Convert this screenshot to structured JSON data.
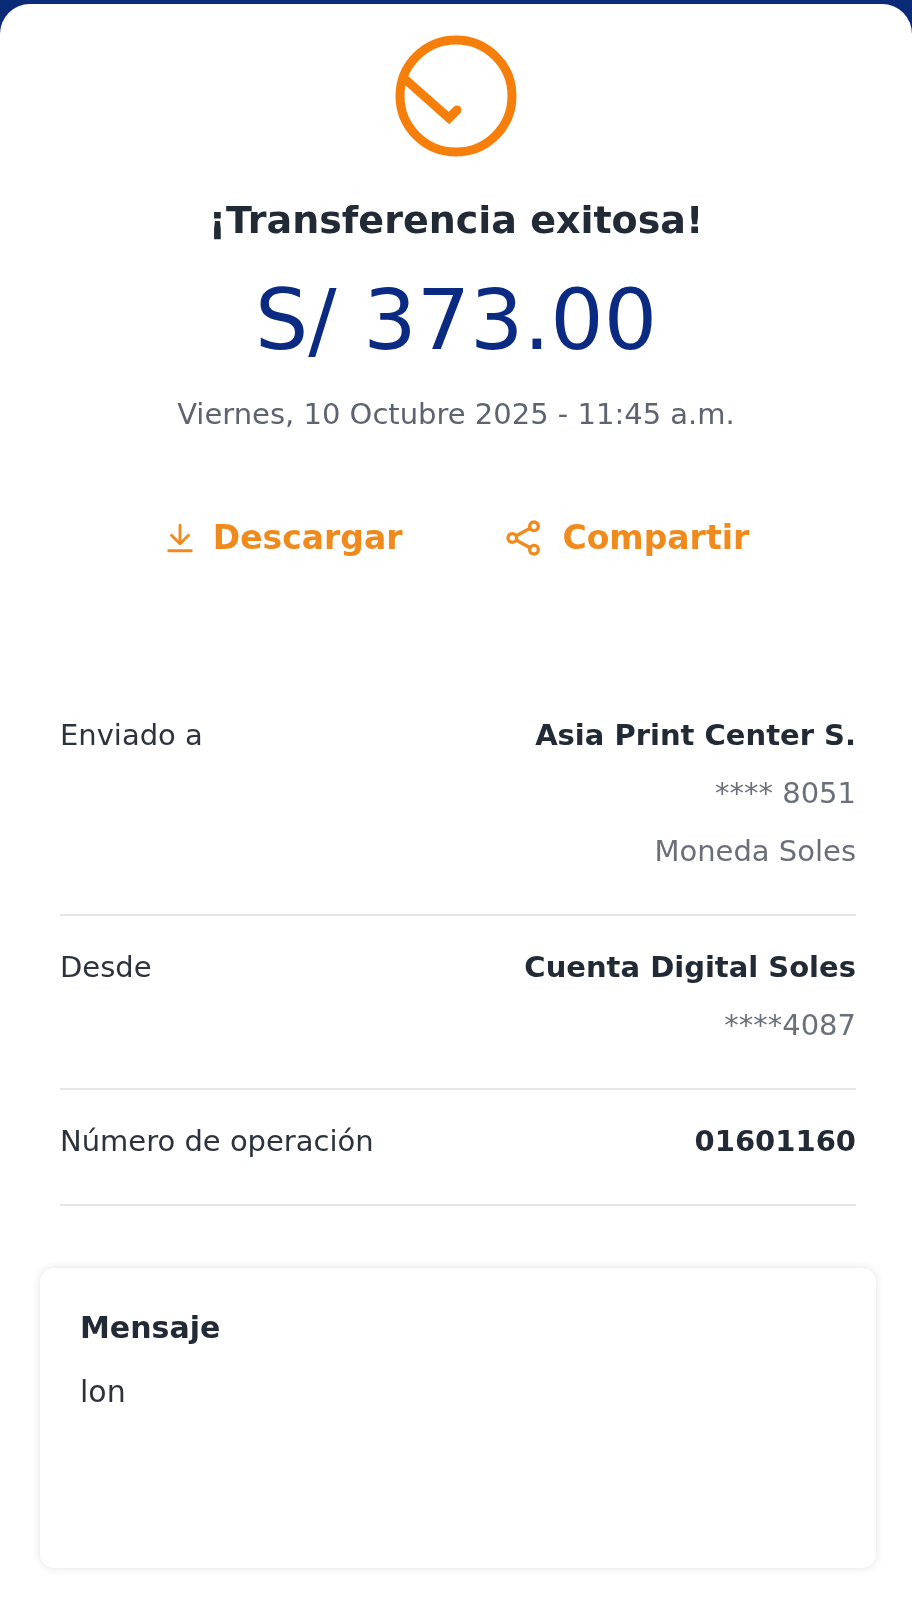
{
  "title": "¡Transferencia exitosa!",
  "amount": "S/ 373.00",
  "date": "Viernes, 10 Octubre 2025 - 11:45 a.m.",
  "actions": [
    {
      "kind": "download",
      "label": "Descargar"
    },
    {
      "kind": "share",
      "label": "Compartir"
    }
  ],
  "details": [
    {
      "label": "Enviado a",
      "lines": [
        {
          "kind": "primary",
          "text": "Asia Print Center S."
        },
        {
          "kind": "secondary",
          "text": "**** 8051"
        },
        {
          "kind": "secondary",
          "text": "Moneda Soles"
        }
      ]
    },
    {
      "label": "Desde",
      "lines": [
        {
          "kind": "primary",
          "text": "Cuenta Digital Soles"
        },
        {
          "kind": "secondary",
          "text": "****4087"
        }
      ]
    },
    {
      "label": "Número de operación",
      "lines": [
        {
          "kind": "primary",
          "text": "01601160"
        }
      ]
    }
  ],
  "message": {
    "heading": "Mensaje",
    "text": "lon"
  }
}
